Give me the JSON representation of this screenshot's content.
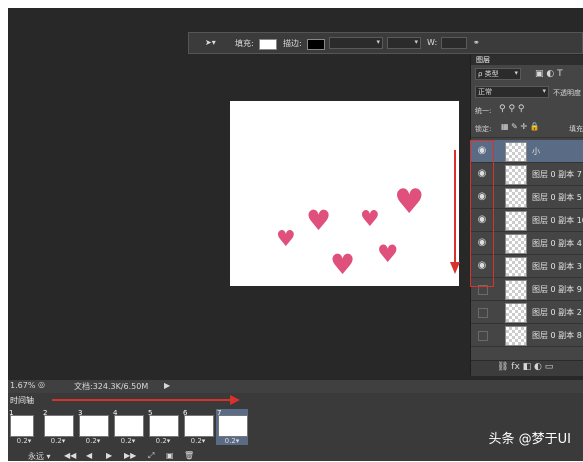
{
  "options_bar": {
    "fill_label": "填充:",
    "stroke_label": "描边:",
    "width_label": "W:"
  },
  "layers_panel": {
    "tab": "图层",
    "kind_filter": "ρ 类型",
    "blend_mode": "正常",
    "opacity_label": "不透明度",
    "unify_label": "统一:",
    "lock_label": "锁定:",
    "fill_label": "填充",
    "layers": [
      {
        "name": "小",
        "visible": true,
        "selected": true
      },
      {
        "name": "图层 0 副本 7",
        "visible": true
      },
      {
        "name": "图层 0 副本 5",
        "visible": true
      },
      {
        "name": "图层 0 副本 10",
        "visible": true
      },
      {
        "name": "图层 0 副本 4",
        "visible": true
      },
      {
        "name": "图层 0 副本 3",
        "visible": true
      },
      {
        "name": "图层 0 副本 9",
        "visible": false
      },
      {
        "name": "图层 0 副本 2",
        "visible": false
      },
      {
        "name": "图层 0 副本 8",
        "visible": false
      }
    ]
  },
  "status_bar": {
    "zoom": "1.67%",
    "doc_info": "文档:324.3K/6.50M"
  },
  "timeline": {
    "title": "时间轴",
    "loop": "永远",
    "frames": [
      {
        "num": "1",
        "delay": "0.2▾"
      },
      {
        "num": "2",
        "delay": "0.2▾"
      },
      {
        "num": "3",
        "delay": "0.2▾"
      },
      {
        "num": "4",
        "delay": "0.2▾"
      },
      {
        "num": "5",
        "delay": "0.2▾"
      },
      {
        "num": "6",
        "delay": "0.2▾"
      },
      {
        "num": "7",
        "delay": "0.2▾"
      }
    ]
  },
  "watermark": "头条 @梦于UI",
  "colors": {
    "heart": "#e0507c",
    "annotation_red": "#d9322d"
  }
}
